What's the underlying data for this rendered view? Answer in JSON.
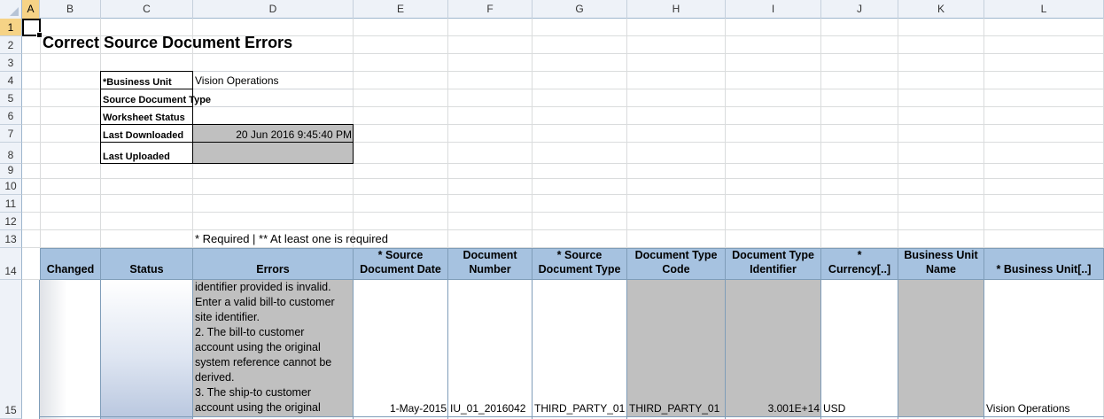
{
  "columns": [
    "A",
    "B",
    "C",
    "D",
    "E",
    "F",
    "G",
    "H",
    "I",
    "J",
    "K",
    "L"
  ],
  "rows": [
    "1",
    "2",
    "3",
    "4",
    "5",
    "6",
    "7",
    "8",
    "9",
    "10",
    "11",
    "12",
    "13",
    "14",
    "15"
  ],
  "title": "Correct Source Document Errors",
  "info": {
    "business_unit_label": "*Business Unit",
    "business_unit_value": "Vision Operations",
    "source_doc_type_label": "Source Document Type",
    "worksheet_status_label": "Worksheet Status",
    "last_downloaded_label": "Last Downloaded",
    "last_downloaded_value": "20 Jun 2016 9:45:40 PM",
    "last_uploaded_label": "Last Uploaded"
  },
  "required_note": "* Required | ** At least one is required",
  "table": {
    "headers": {
      "changed": "Changed",
      "status": "Status",
      "errors": "Errors",
      "source_doc_date_1": "* Source",
      "source_doc_date_2": "Document Date",
      "document_number_1": "Document",
      "document_number_2": "Number",
      "source_doc_type_1": "* Source",
      "source_doc_type_2": "Document Type",
      "doc_type_code_1": "Document Type",
      "doc_type_code_2": "Code",
      "doc_type_identifier_1": "Document Type",
      "doc_type_identifier_2": "Identifier",
      "currency_1": "*",
      "currency_2": "Currency[..]",
      "bu_name_1": "Business Unit",
      "bu_name_2": "Name",
      "business_unit": "* Business Unit[..]"
    },
    "row15": {
      "errors_lines": [
        "identifier provided is invalid.",
        "Enter a valid bill-to customer",
        "site identifier.",
        "2. The bill-to customer",
        "account using the original",
        "system reference cannot be",
        "derived.",
        "3. The ship-to customer",
        "account using the original"
      ],
      "source_doc_date": "1-May-2015",
      "document_number": "IU_01_2016042",
      "source_doc_type": "THIRD_PARTY_01",
      "doc_type_code": "THIRD_PARTY_01",
      "doc_type_identifier": "3.001E+14",
      "currency": "USD",
      "business_unit": "Vision Operations"
    }
  },
  "colors": {
    "header_fill": "#a6c2e0",
    "gray_fill": "#c0c0c0",
    "selection": "#f6d386"
  }
}
